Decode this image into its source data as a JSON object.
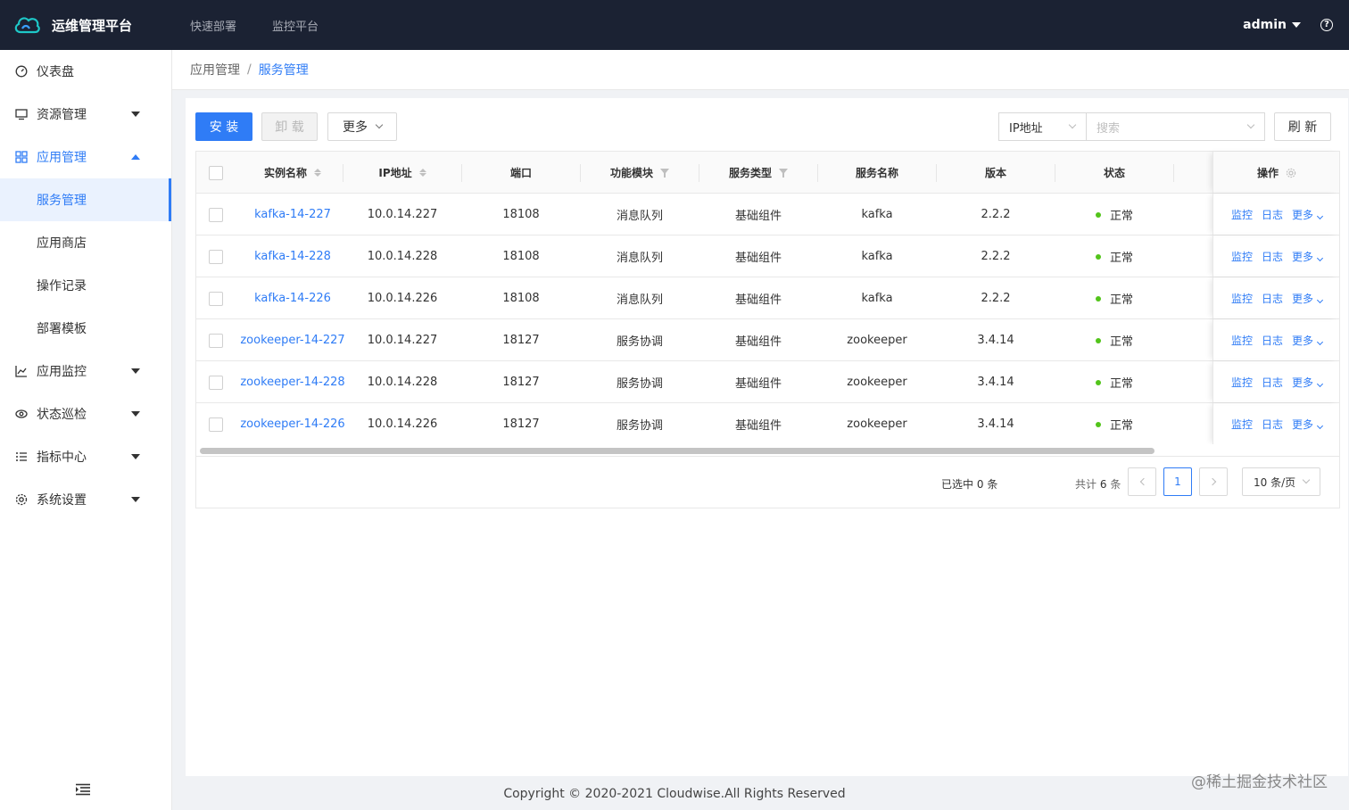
{
  "app": {
    "title": "运维管理平台",
    "user": "admin"
  },
  "top_nav": [
    "快速部署",
    "监控平台"
  ],
  "sidebar": {
    "items": [
      {
        "label": "仪表盘"
      },
      {
        "label": "资源管理"
      },
      {
        "label": "应用管理"
      },
      {
        "label": "应用监控"
      },
      {
        "label": "状态巡检"
      },
      {
        "label": "指标中心"
      },
      {
        "label": "系统设置"
      }
    ],
    "sub_items": [
      "服务管理",
      "应用商店",
      "操作记录",
      "部署模板"
    ]
  },
  "breadcrumb": {
    "first": "应用管理",
    "separator": "/",
    "current": "服务管理"
  },
  "toolbar": {
    "install": "安 装",
    "uninstall": "卸 载",
    "more": "更多",
    "search_field": "IP地址",
    "search_placeholder": "搜索",
    "refresh": "刷 新"
  },
  "table": {
    "headers": {
      "name": "实例名称",
      "ip": "IP地址",
      "port": "端口",
      "module": "功能模块",
      "type": "服务类型",
      "service": "服务名称",
      "version": "版本",
      "status": "状态",
      "ops": "操作"
    },
    "rows": [
      {
        "name": "kafka-14-227",
        "ip": "10.0.14.227",
        "port": "18108",
        "module": "消息队列",
        "type": "基础组件",
        "service": "kafka",
        "version": "2.2.2",
        "status": "正常"
      },
      {
        "name": "kafka-14-228",
        "ip": "10.0.14.228",
        "port": "18108",
        "module": "消息队列",
        "type": "基础组件",
        "service": "kafka",
        "version": "2.2.2",
        "status": "正常"
      },
      {
        "name": "kafka-14-226",
        "ip": "10.0.14.226",
        "port": "18108",
        "module": "消息队列",
        "type": "基础组件",
        "service": "kafka",
        "version": "2.2.2",
        "status": "正常"
      },
      {
        "name": "zookeeper-14-227",
        "ip": "10.0.14.227",
        "port": "18127",
        "module": "服务协调",
        "type": "基础组件",
        "service": "zookeeper",
        "version": "3.4.14",
        "status": "正常"
      },
      {
        "name": "zookeeper-14-228",
        "ip": "10.0.14.228",
        "port": "18127",
        "module": "服务协调",
        "type": "基础组件",
        "service": "zookeeper",
        "version": "3.4.14",
        "status": "正常"
      },
      {
        "name": "zookeeper-14-226",
        "ip": "10.0.14.226",
        "port": "18127",
        "module": "服务协调",
        "type": "基础组件",
        "service": "zookeeper",
        "version": "3.4.14",
        "status": "正常"
      }
    ],
    "ops": {
      "monitor": "监控",
      "log": "日志",
      "more": "更多"
    }
  },
  "pagination": {
    "selected_prefix": "已选中",
    "selected_count": "0",
    "selected_suffix": "条",
    "total_prefix": "共计",
    "total_count": "6",
    "total_suffix": "条",
    "current_page": "1",
    "page_size": "10 条/页"
  },
  "footer": {
    "copyright": "Copyright © 2020-2021 Cloudwise.All Rights Reserved"
  },
  "watermark": "@稀土掘金技术社区",
  "colors": {
    "primary": "#2f7cf6",
    "header_bg": "#1b2233",
    "status_ok": "#52c41a"
  }
}
